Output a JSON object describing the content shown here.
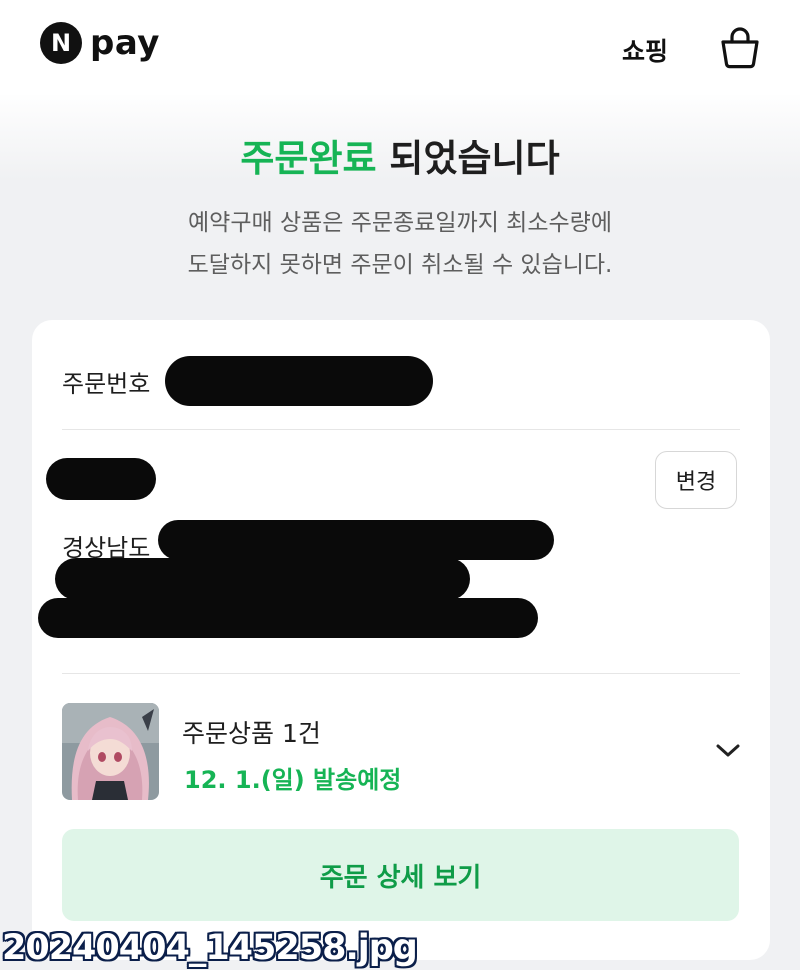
{
  "header": {
    "logo_mark": "N",
    "logo_text": "pay",
    "shop_label": "쇼핑",
    "bag_icon": "shopping-bag-icon"
  },
  "headline": {
    "accent": "주문완료",
    "rest": " 되었습니다"
  },
  "notice": {
    "line1": "예약구매 상품은 주문종료일까지 최소수량에",
    "line2": "도달하지 못하면 주문이 취소될 수 있습니다."
  },
  "order": {
    "number_label": "주문번호"
  },
  "address": {
    "change_label": "변경",
    "region": "경상남도"
  },
  "product": {
    "count_text": "주문상품 1건",
    "shipping_text": "12. 1.(일) 발송예정",
    "expand_icon": "chevron-down-icon"
  },
  "detail_button": "주문 상세 보기",
  "file_name": "20240404_145258.jpg",
  "colors": {
    "accent": "#16b455",
    "button_bg": "#dff5e8"
  }
}
